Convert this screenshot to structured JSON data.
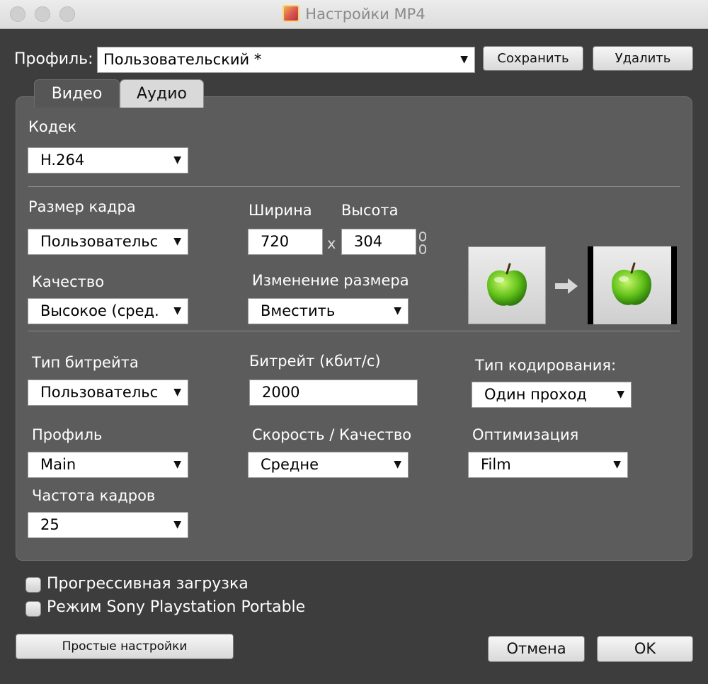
{
  "window": {
    "title": "Настройки MP4",
    "app_icon": "app-icon"
  },
  "profile_bar": {
    "label": "Профиль:",
    "value": "Пользовательский *",
    "save_label": "Сохранить",
    "delete_label": "Удалить"
  },
  "tabs": [
    {
      "label": "Видео",
      "active": true
    },
    {
      "label": "Аудио",
      "active": false
    }
  ],
  "video": {
    "codec": {
      "label": "Кодек",
      "value": "H.264"
    },
    "frame_size": {
      "label": "Размер кадра",
      "value": "Пользовательс"
    },
    "width": {
      "label": "Ширина",
      "value": "720"
    },
    "height": {
      "label": "Высота",
      "value": "304"
    },
    "times_sign": "x",
    "quality": {
      "label": "Качество",
      "value": "Высокое (сред."
    },
    "resize": {
      "label": "Изменение размера",
      "value": "Вместить"
    },
    "bitrate_type": {
      "label": "Тип битрейта",
      "value": "Пользовательс"
    },
    "bitrate": {
      "label": "Битрейт (кбит/с)",
      "value": "2000"
    },
    "encoding_type": {
      "label": "Тип кодирования:",
      "value": "Один проход"
    },
    "profile": {
      "label": "Профиль",
      "value": "Main"
    },
    "speed_quality": {
      "label": "Скорость / Качество",
      "value": "Средне"
    },
    "optimization": {
      "label": "Оптимизация",
      "value": "Film"
    },
    "frame_rate": {
      "label": "Частота кадров",
      "value": "25"
    }
  },
  "options": {
    "progressive": {
      "label": "Прогрессивная загрузка",
      "checked": false
    },
    "psp": {
      "label": "Режим Sony Playstation Portable",
      "checked": false
    }
  },
  "footer": {
    "simple_label": "Простые настройки",
    "cancel_label": "Отмена",
    "ok_label": "OK"
  }
}
